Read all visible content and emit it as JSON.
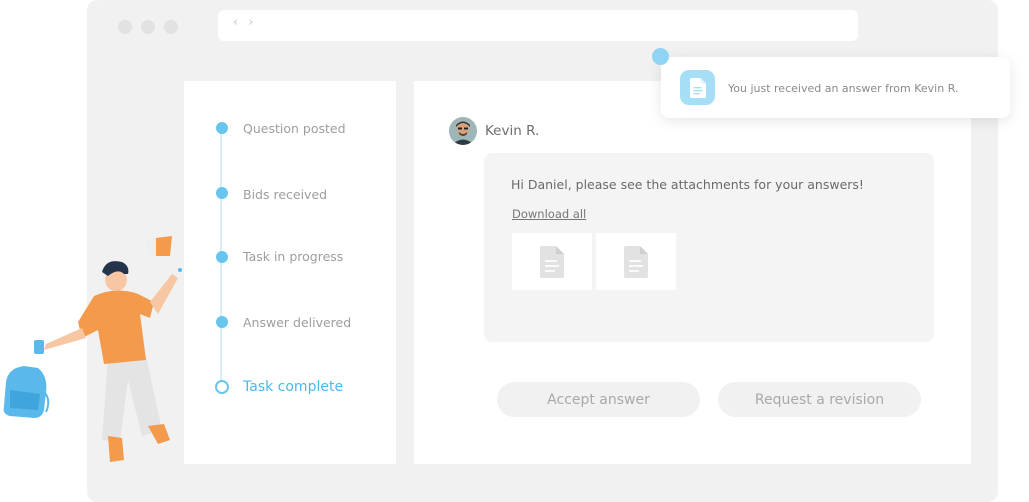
{
  "browser": {
    "nav_arrows": "‹ ›"
  },
  "steps": [
    {
      "label": "Question posted",
      "state": "done"
    },
    {
      "label": "Bids received",
      "state": "done"
    },
    {
      "label": "Task in progress",
      "state": "done"
    },
    {
      "label": "Answer delivered",
      "state": "done"
    },
    {
      "label": "Task complete",
      "state": "current"
    }
  ],
  "message": {
    "sender": "Kevin R.",
    "avatar_icon": "user-avatar",
    "text": "Hi Daniel, please see the attachments for your answers!",
    "download_label": "Download all",
    "attachments": [
      {
        "icon": "document-icon"
      },
      {
        "icon": "document-icon"
      }
    ]
  },
  "actions": {
    "accept_label": "Accept answer",
    "revision_label": "Request a revision"
  },
  "notification": {
    "icon": "document-icon",
    "text": "You just received an answer from Kevin R."
  },
  "colors": {
    "accent": "#4bb8ea",
    "step_dot": "#68c5ee",
    "notification_icon_bg": "#a6def6",
    "window_bg": "#f1f1f1",
    "illustration_shirt": "#f39a4d"
  }
}
